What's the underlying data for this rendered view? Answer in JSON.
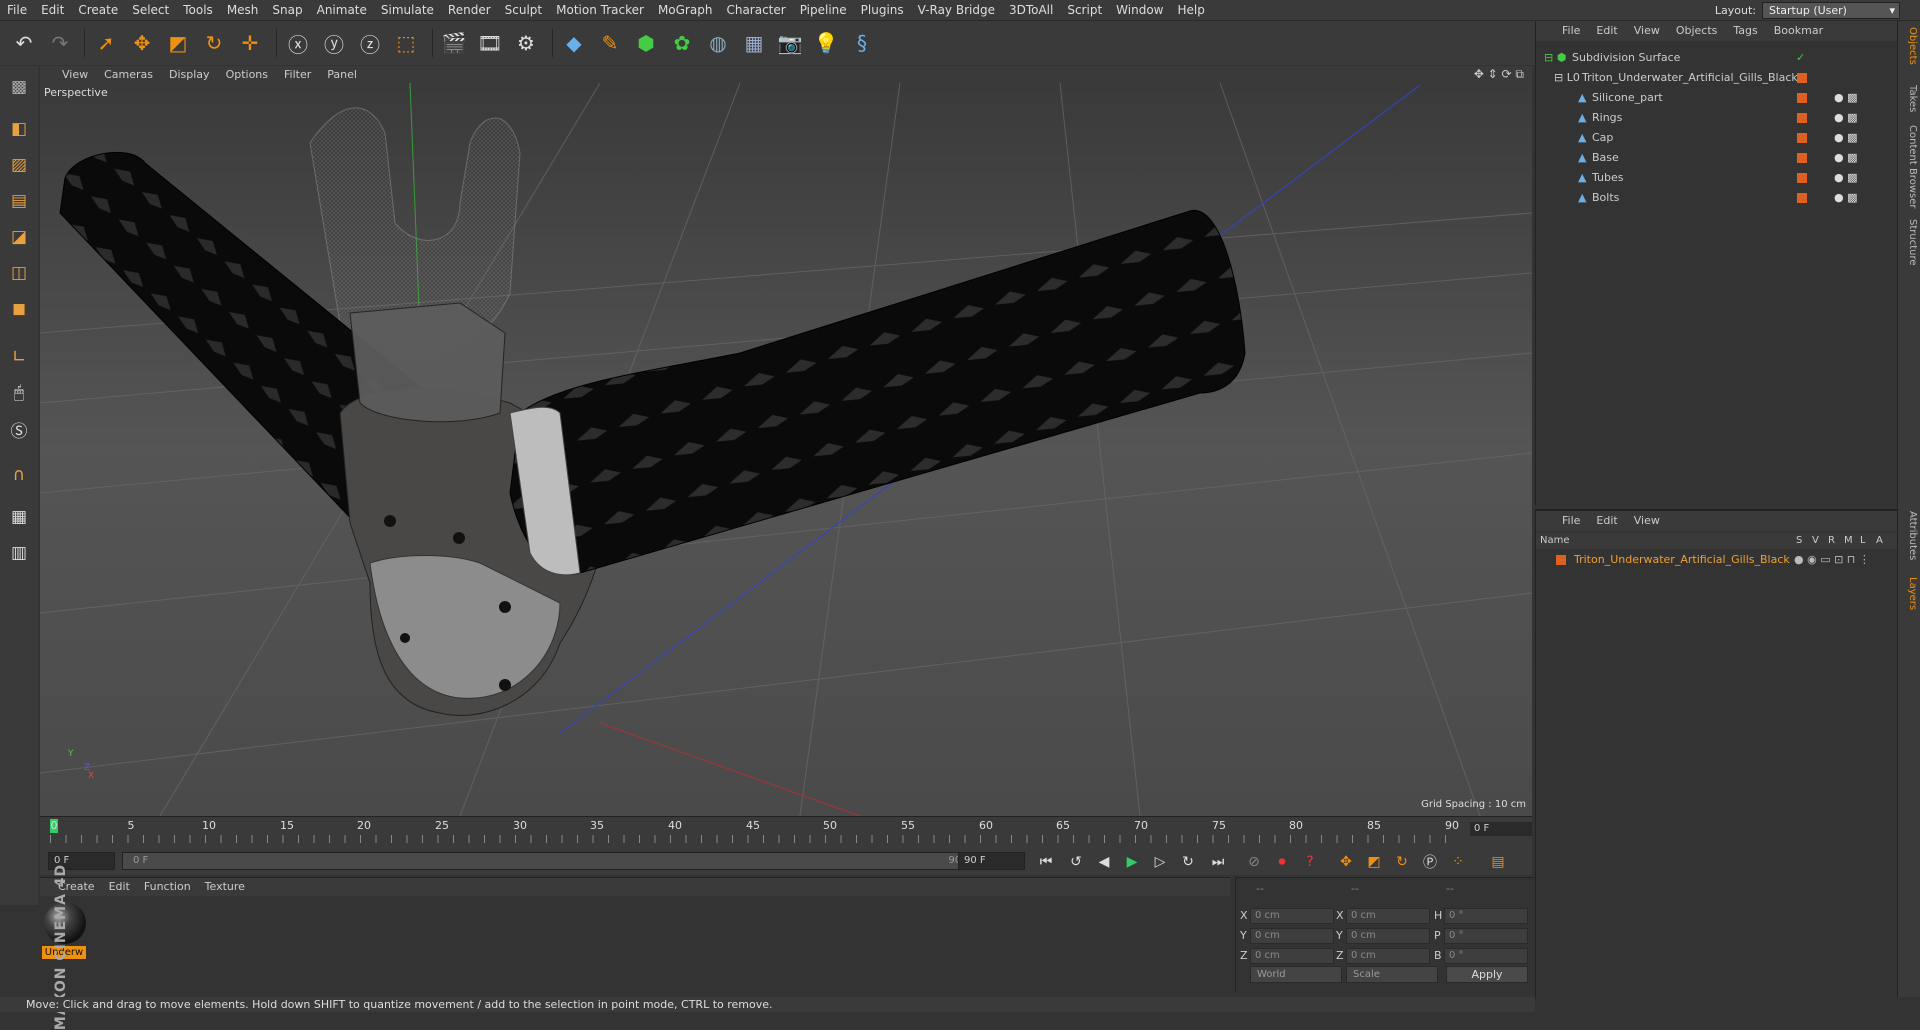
{
  "menu": [
    "File",
    "Edit",
    "Create",
    "Select",
    "Tools",
    "Mesh",
    "Snap",
    "Animate",
    "Simulate",
    "Render",
    "Sculpt",
    "Motion Tracker",
    "MoGraph",
    "Character",
    "Pipeline",
    "Plugins",
    "V-Ray Bridge",
    "3DToAll",
    "Script",
    "Window",
    "Help"
  ],
  "layout": {
    "label": "Layout:",
    "value": "Startup (User)"
  },
  "viewport": {
    "menu": [
      "View",
      "Cameras",
      "Display",
      "Options",
      "Filter",
      "Panel"
    ],
    "camera_label": "Perspective",
    "grid_spacing": "Grid Spacing : 10 cm",
    "axis_y": "Y",
    "axis_z": "Z",
    "axis_x": "X"
  },
  "timeline": {
    "ticks": [
      "0",
      "5",
      "10",
      "15",
      "20",
      "25",
      "30",
      "35",
      "40",
      "45",
      "50",
      "55",
      "60",
      "65",
      "70",
      "75",
      "80",
      "85",
      "90"
    ],
    "current_frame": "0 F"
  },
  "transport": {
    "start_field": "0 F",
    "range_start": "0 F",
    "range_end": "90 F",
    "end_field": "90 F"
  },
  "material_manager": {
    "menu": [
      "Create",
      "Edit",
      "Function",
      "Texture"
    ],
    "material_name": "Underw"
  },
  "brand": "MAXON CINEMA 4D",
  "coordinates": {
    "headers": [
      "--",
      "--",
      "--"
    ],
    "rows": [
      {
        "a": "X",
        "av": "0 cm",
        "b": "X",
        "bv": "0 cm",
        "c": "H",
        "cv": "0 °"
      },
      {
        "a": "Y",
        "av": "0 cm",
        "b": "Y",
        "bv": "0 cm",
        "c": "P",
        "cv": "0 °"
      },
      {
        "a": "Z",
        "av": "0 cm",
        "b": "Z",
        "bv": "0 cm",
        "c": "B",
        "cv": "0 °"
      }
    ],
    "space": "World",
    "mode": "Scale",
    "apply": "Apply"
  },
  "status": "Move: Click and drag to move elements. Hold down SHIFT to quantize movement / add to the selection in point mode, CTRL to remove.",
  "object_manager": {
    "menu": [
      "File",
      "Edit",
      "View",
      "Objects",
      "Tags",
      "Bookmar"
    ],
    "objects": [
      {
        "name": "Subdivision Surface",
        "indent": 0
      },
      {
        "name": "Triton_Underwater_Artificial_Gills_Black",
        "indent": 1
      },
      {
        "name": "Silicone_part",
        "indent": 2
      },
      {
        "name": "Rings",
        "indent": 2
      },
      {
        "name": "Cap",
        "indent": 2
      },
      {
        "name": "Base",
        "indent": 2
      },
      {
        "name": "Tubes",
        "indent": 2
      },
      {
        "name": "Bolts",
        "indent": 2
      }
    ]
  },
  "layer_manager": {
    "menu": [
      "File",
      "Edit",
      "View"
    ],
    "header_name": "Name",
    "columns": [
      "S",
      "V",
      "R",
      "M",
      "L",
      "A"
    ],
    "layer": "Triton_Underwater_Artificial_Gills_Black"
  },
  "side_tabs": [
    "Objects",
    "Takes",
    "Content Browser",
    "Structure",
    "Attributes",
    "Layers"
  ],
  "colors": {
    "accent": "#f09010",
    "layer_text": "#f0a030"
  }
}
